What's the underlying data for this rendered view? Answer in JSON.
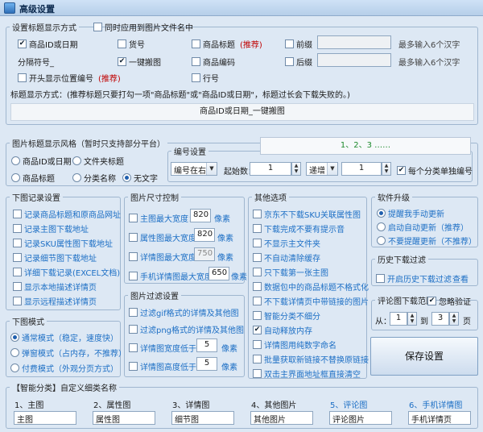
{
  "window": {
    "title": "高级设置"
  },
  "s1": {
    "legend": "设置标题显示方式",
    "apply_to_filename": "同时应用到图片文件名中",
    "r1": {
      "a": "商品ID或日期",
      "b": "货号",
      "c": "商品标题",
      "c_note": "(推荐)",
      "d": "前缀",
      "hint": "最多输入6个汉字"
    },
    "sep_label": "分隔符号_",
    "r2": {
      "b": "一键搬图",
      "c": "商品编码",
      "d": "后缀",
      "hint": "最多输入6个汉字"
    },
    "r3": {
      "a": "开头显示位置编号",
      "a_note": "(推荐)",
      "d": "行号"
    },
    "desc": "标题显示方式：(推荐标题只要打勾一项\"商品标题\"或\"商品ID或日期\"，标题过长会下载失败的。)",
    "preview": "商品ID或日期_一键搬图"
  },
  "s2": {
    "legend": "图片标题显示风格（暂时只支持部分平台）",
    "opt1": "商品ID或日期",
    "opt2": "文件夹标题",
    "opt3": "商品标题",
    "opt4": "分类名称",
    "opt5": "无文字",
    "num": {
      "legend": "编号设置",
      "preview": "1、2、3 ……",
      "pos": "编号在右",
      "start_label": "起始数：",
      "start": "1",
      "mode": "递增",
      "step": "1",
      "per_class": "每个分类单独编号"
    }
  },
  "s3": {
    "legend": "下图记录设置",
    "items": [
      "记录商品标题和原商品网址",
      "记录主图下载地址",
      "记录SKU属性图下载地址",
      "记录细节图下载地址",
      "详细下载记录(EXCEL文档)",
      "显示本地描述详情页",
      "显示远程描述详情页"
    ]
  },
  "s4": {
    "legend": "图片尺寸控制",
    "items": [
      {
        "label": "主图最大宽度：",
        "val": "820",
        "unit": "像素"
      },
      {
        "label": "属性图最大宽度：",
        "val": "820",
        "unit": "像素"
      },
      {
        "label": "详情图最大宽度：",
        "val": "750",
        "unit": "像素"
      },
      {
        "label": "手机详情图最大宽度：",
        "val": "650",
        "unit": "像素"
      }
    ]
  },
  "s5": {
    "legend": "其他选项",
    "items": [
      "京东不下载SKU关联属性图",
      "下载完成不要有提示音",
      "不显示主文件夹",
      "不自动清除缓存",
      "只下载第一张主图",
      "数据包中的商品标题不格式化",
      "不下载详情页中带链接的图片",
      "智能分类不细分",
      "自动释放内存",
      "详情图用纯数字命名",
      "批量获取新链接不替换原链接",
      "双击主界面地址框直接清空"
    ]
  },
  "s6": {
    "legend": "软件升级",
    "items": [
      "提醒我手动更新",
      "启动自动更新（推荐）",
      "不要提醒更新（不推荐）"
    ]
  },
  "s7": {
    "legend": "历史下载过滤",
    "enable": "开启历史下载过滤",
    "view": "查看"
  },
  "s8": {
    "legend": "评论图下载范围",
    "auto_verify": "忽略验证",
    "from": "从：",
    "from_val": "1",
    "to": "到",
    "to_val": "3",
    "unit": "页"
  },
  "save": "保存设置",
  "s9": {
    "legend": "下图模式",
    "items": [
      "通常模式（稳定，速度快）",
      "弹窗模式（占内存，不推荐）",
      "付费模式（外观分页方式）"
    ]
  },
  "s10": {
    "legend": "图片过滤设置",
    "items": [
      {
        "label": "过滤gif格式的详情及其他图"
      },
      {
        "label": "过滤png格式的详情及其他图"
      },
      {
        "label": "详情图宽度低于：",
        "val": "5",
        "unit": "像素"
      },
      {
        "label": "详情图高度低于：",
        "val": "5",
        "unit": "像素"
      }
    ]
  },
  "s11": {
    "legend": "【智能分类】自定义细类名称",
    "cols": [
      {
        "h": "1、主图",
        "v": "主图"
      },
      {
        "h": "2、属性图",
        "v": "属性图"
      },
      {
        "h": "3、详情图",
        "v": "细节图"
      },
      {
        "h": "4、其他图片",
        "v": "其他图片"
      },
      {
        "h": "5、评论图",
        "v": "评论图片"
      },
      {
        "h": "6、手机详情图",
        "v": "手机详情页"
      }
    ]
  },
  "colors": {
    "accent": "#1d6fc5",
    "warn": "#c00000",
    "preview_text": "#1e8a2e"
  }
}
